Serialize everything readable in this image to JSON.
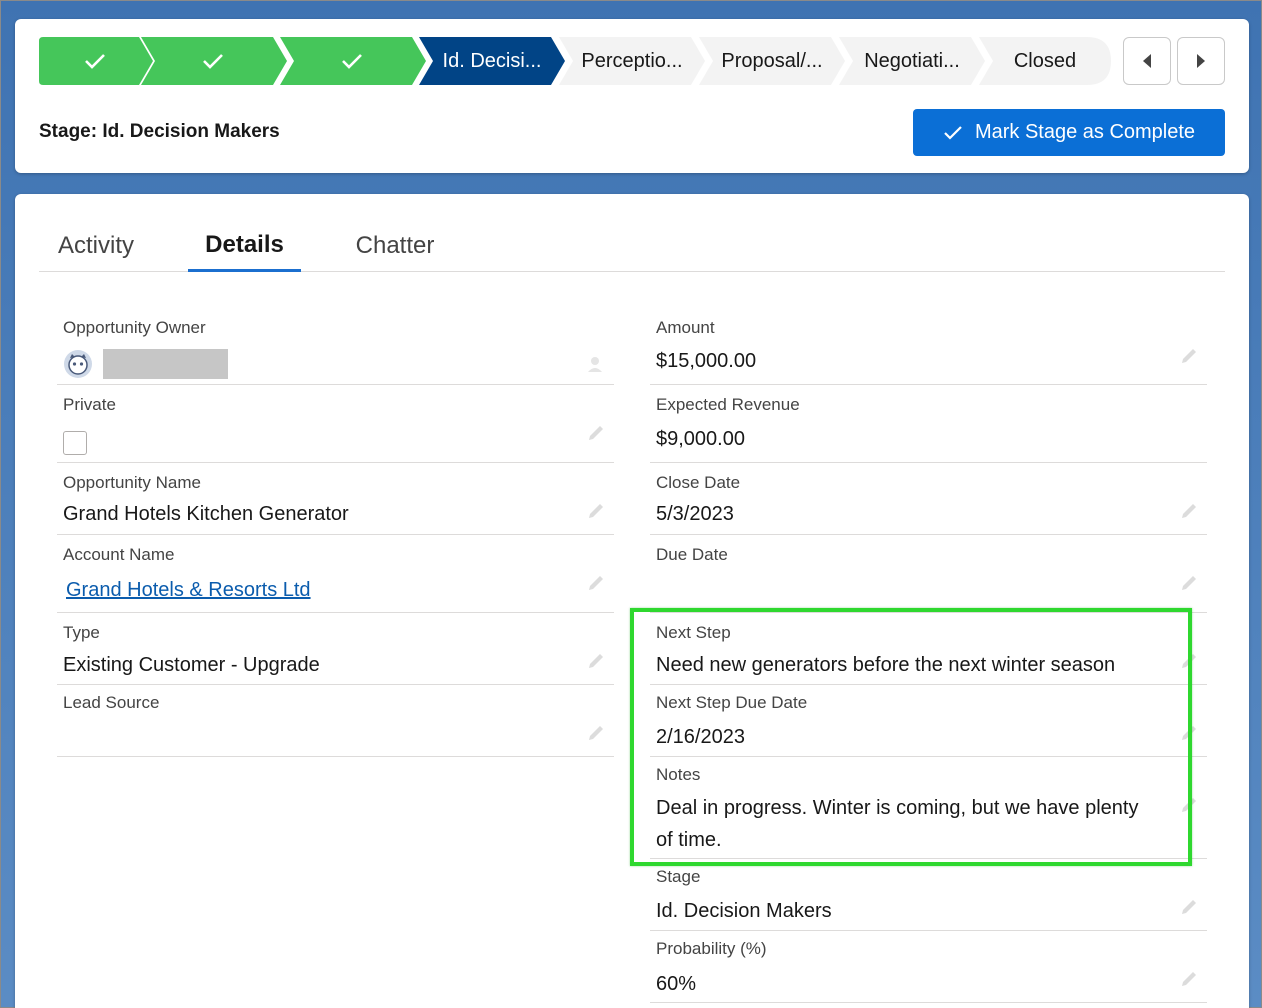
{
  "path": {
    "stages": [
      {
        "label": "",
        "state": "complete"
      },
      {
        "label": "",
        "state": "complete"
      },
      {
        "label": "",
        "state": "complete"
      },
      {
        "label": "Id. Decisi...",
        "state": "current"
      },
      {
        "label": "Perceptio...",
        "state": "upcoming"
      },
      {
        "label": "Proposal/...",
        "state": "upcoming"
      },
      {
        "label": "Negotiati...",
        "state": "upcoming"
      },
      {
        "label": "Closed",
        "state": "upcoming"
      }
    ],
    "stage_label": "Stage: Id. Decision Makers",
    "mark_complete_label": "Mark Stage as Complete"
  },
  "tabs": [
    {
      "label": "Activity"
    },
    {
      "label": "Details"
    },
    {
      "label": "Chatter"
    }
  ],
  "left_fields": {
    "owner": {
      "label": "Opportunity Owner",
      "value": ""
    },
    "private": {
      "label": "Private",
      "value": ""
    },
    "opp_name": {
      "label": "Opportunity Name",
      "value": "Grand Hotels Kitchen Generator"
    },
    "account": {
      "label": "Account Name",
      "value": "Grand Hotels & Resorts Ltd"
    },
    "type": {
      "label": "Type",
      "value": "Existing Customer - Upgrade"
    },
    "lead_source": {
      "label": "Lead Source",
      "value": ""
    }
  },
  "right_fields": {
    "amount": {
      "label": "Amount",
      "value": "$15,000.00"
    },
    "expected_revenue": {
      "label": "Expected Revenue",
      "value": "$9,000.00"
    },
    "close_date": {
      "label": "Close Date",
      "value": "5/3/2023"
    },
    "due_date": {
      "label": "Due Date",
      "value": ""
    },
    "next_step": {
      "label": "Next Step",
      "value": "Need new generators before the next winter season"
    },
    "next_step_due": {
      "label": "Next Step Due Date",
      "value": "2/16/2023"
    },
    "notes": {
      "label": "Notes",
      "value_line1": "Deal in progress. Winter is coming, but we have plenty",
      "value_line2": "of time."
    },
    "stage": {
      "label": "Stage",
      "value": "Id. Decision Makers"
    },
    "probability": {
      "label": "Probability (%)",
      "value": "60%"
    }
  },
  "colors": {
    "complete": "#45c65a",
    "current": "#014486",
    "upcoming": "#f3f3f3",
    "brand": "#0b6fd6",
    "highlight": "#2fd82f"
  }
}
